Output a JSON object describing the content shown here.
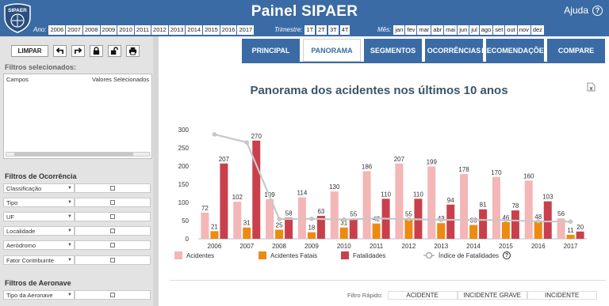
{
  "header": {
    "logo_text": "SIPAER",
    "title": "Painel SIPAER",
    "help_label": "Ajuda",
    "year_label": "Ano:",
    "years": [
      "2006",
      "2007",
      "2008",
      "2009",
      "2010",
      "2011",
      "2012",
      "2013",
      "2014",
      "2015",
      "2016",
      "2017"
    ],
    "quarter_label": "Trimestre:",
    "quarters": [
      "1T",
      "2T",
      "3T",
      "4T"
    ],
    "month_label": "Mês:",
    "months": [
      "jan",
      "fev",
      "mar",
      "abr",
      "mai",
      "jun",
      "jul",
      "ago",
      "set",
      "out",
      "nov",
      "dez"
    ]
  },
  "left_panel": {
    "clear_label": "LIMPAR",
    "selected_title": "Filtros selecionados:",
    "selected_col_fields": "Campos",
    "selected_col_values": "Valores Selecionados",
    "occurrence_title": "Filtros de Ocorrência",
    "occurrence_filters": [
      "Classificação",
      "Tipo",
      "UF",
      "Localidade",
      "Aeródromo",
      "Fator Contribuinte"
    ],
    "aircraft_title": "Filtros de Aeronave",
    "aircraft_filters": [
      "Tipo da Aeronave"
    ]
  },
  "tabs": [
    "PRINCIPAL",
    "PANORAMA",
    "SEGMENTOS",
    "OCORRÊNCIAS",
    "RECOMENDAÇÕES",
    "COMPARE"
  ],
  "active_tab": "PANORAMA",
  "chart_title": "Panorama dos acidentes nos últimos 10 anos",
  "quick_filter": {
    "label": "Filtro Rápido:",
    "options": [
      "ACIDENTE",
      "INCIDENTE GRAVE",
      "INCIDENTE"
    ]
  },
  "colors": {
    "accent": "#3b6ba4",
    "acidentes": "#f4b6b6",
    "fatais": "#ed8a12",
    "fatalidades": "#c9404c",
    "indice": "#c8c8c8"
  },
  "chart_data": {
    "type": "bar",
    "title": "Panorama dos acidentes nos últimos 10 anos",
    "categories": [
      "2006",
      "2007",
      "2008",
      "2009",
      "2010",
      "2011",
      "2012",
      "2013",
      "2014",
      "2015",
      "2016",
      "2017"
    ],
    "ylim": [
      0,
      300
    ],
    "yticks": [
      0,
      50,
      100,
      150,
      200,
      250,
      300
    ],
    "grid": false,
    "legend_position": "bottom",
    "series": [
      {
        "name": "Acidentes",
        "type": "bar",
        "values": [
          72,
          102,
          109,
          114,
          130,
          186,
          207,
          199,
          178,
          170,
          160,
          56
        ]
      },
      {
        "name": "Acidentes Fatais",
        "type": "bar",
        "values": [
          21,
          31,
          25,
          18,
          31,
          42,
          55,
          43,
          38,
          46,
          48,
          11
        ]
      },
      {
        "name": "Fatalidades",
        "type": "bar",
        "values": [
          207,
          270,
          58,
          63,
          55,
          110,
          110,
          94,
          81,
          78,
          103,
          20
        ]
      },
      {
        "name": "Índice de Fatalidades",
        "type": "line",
        "values": [
          287,
          265,
          54,
          55,
          53,
          56,
          54,
          52,
          52,
          51,
          48,
          47
        ]
      }
    ]
  }
}
